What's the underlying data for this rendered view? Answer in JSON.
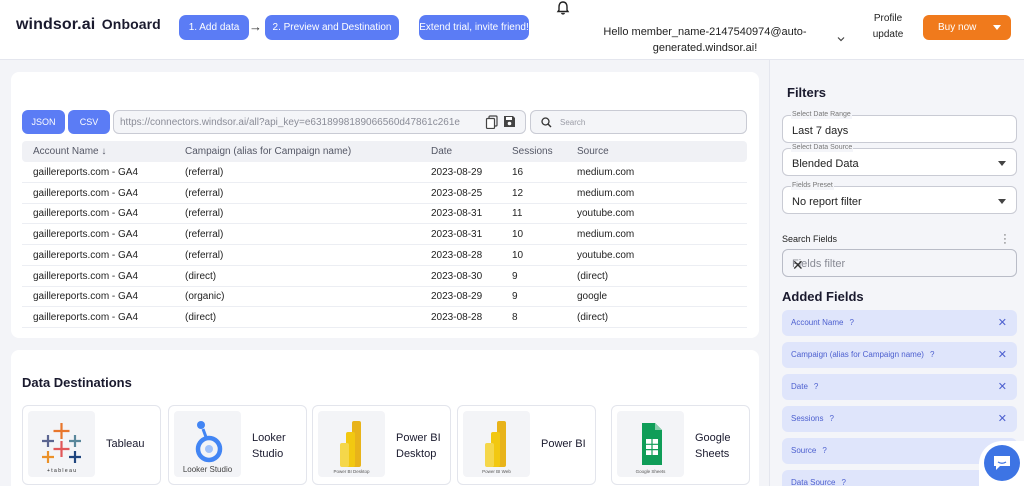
{
  "header": {
    "logo_main": "windsor.ai",
    "logo_sub": "Onboard",
    "steps": [
      "1. Add data",
      "2. Preview and Destination",
      "Extend trial, invite friend!"
    ],
    "step_arrow": "→",
    "greeting_line1": "Hello member_name-2147540974@auto-",
    "greeting_line2": "generated.windsor.ai!",
    "profile_update_line1": "Profile",
    "profile_update_line2": "update",
    "buy_now": "Buy now"
  },
  "toolbar": {
    "json_label": "JSON",
    "csv_label": "CSV",
    "url": "https://connectors.windsor.ai/all?api_key=e6318998189066560d47861c261e",
    "search_placeholder": "Search"
  },
  "table": {
    "columns": [
      "Account Name ↓",
      "Campaign (alias for Campaign name)",
      "Date",
      "Sessions",
      "Source"
    ],
    "rows": [
      [
        "gaillereports.com - GA4",
        "(referral)",
        "2023-08-29",
        "16",
        "medium.com"
      ],
      [
        "gaillereports.com - GA4",
        "(referral)",
        "2023-08-25",
        "12",
        "medium.com"
      ],
      [
        "gaillereports.com - GA4",
        "(referral)",
        "2023-08-31",
        "11",
        "youtube.com"
      ],
      [
        "gaillereports.com - GA4",
        "(referral)",
        "2023-08-31",
        "10",
        "medium.com"
      ],
      [
        "gaillereports.com - GA4",
        "(referral)",
        "2023-08-28",
        "10",
        "youtube.com"
      ],
      [
        "gaillereports.com - GA4",
        "(direct)",
        "2023-08-30",
        "9",
        "(direct)"
      ],
      [
        "gaillereports.com - GA4",
        "(organic)",
        "2023-08-29",
        "9",
        "google"
      ],
      [
        "gaillereports.com - GA4",
        "(direct)",
        "2023-08-28",
        "8",
        "(direct)"
      ]
    ]
  },
  "destinations": {
    "title": "Data Destinations",
    "tiles": [
      {
        "label1": "Tableau",
        "label2": "",
        "icon_caption": "+ t a b l e a u"
      },
      {
        "label1": "Looker",
        "label2": "Studio",
        "icon_caption": "Looker Studio"
      },
      {
        "label1": "Power BI",
        "label2": "Desktop",
        "icon_caption": "Power BI Desktop"
      },
      {
        "label1": "Power BI",
        "label2": "",
        "icon_caption": "Power BI Web"
      },
      {
        "label1": "Google",
        "label2": "Sheets",
        "icon_caption": "Google Sheets"
      }
    ]
  },
  "filters": {
    "title": "Filters",
    "date_range_label": "Select Date Range",
    "date_range_value": "Last 7 days",
    "data_source_label": "Select Data Source",
    "data_source_value": "Blended Data",
    "fields_preset_label": "Fields Preset",
    "fields_preset_value": "No report filter",
    "search_fields_label": "Search Fields",
    "fields_filter_placeholder": "Fields filter",
    "added_fields_title": "Added Fields",
    "added_fields": [
      "Account Name",
      "Campaign (alias for Campaign name)",
      "Date",
      "Sessions",
      "Source",
      "Data Source"
    ],
    "help_mark": "?"
  },
  "colors": {
    "accent": "#5b7cf5",
    "buy_now": "#f07a1c",
    "chip_bg": "#dfe5fb",
    "chat": "#3d74e4"
  }
}
